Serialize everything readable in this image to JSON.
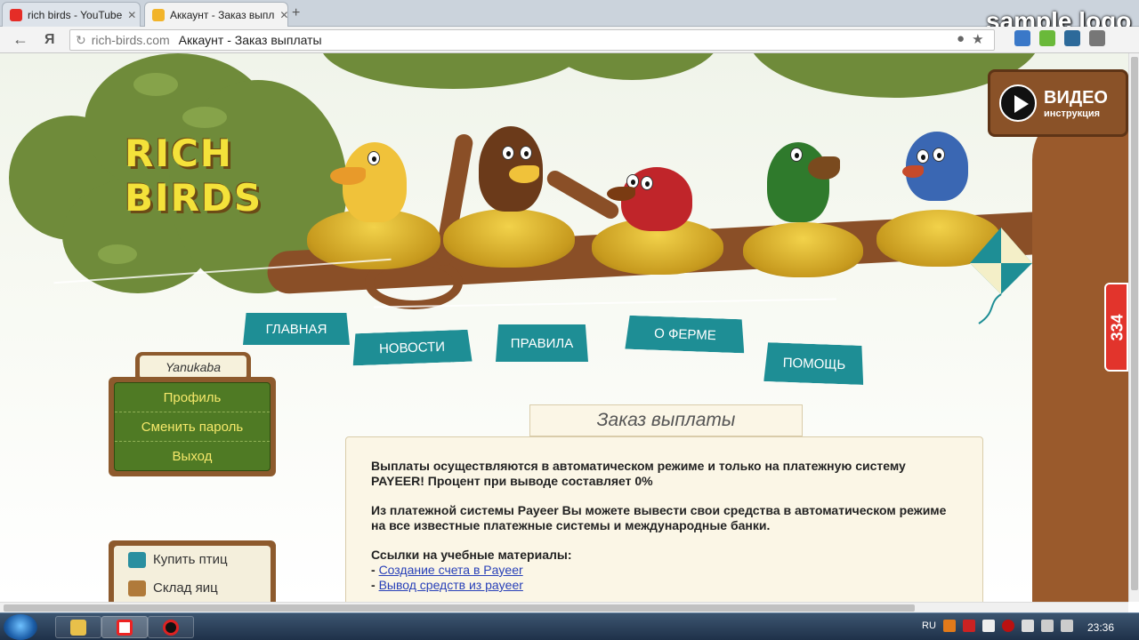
{
  "browser": {
    "tabs": [
      {
        "title": "rich birds - YouTube",
        "active": false
      },
      {
        "title": "Аккаунт - Заказ выпл",
        "active": true
      }
    ],
    "new_tab_symbol": "+",
    "watermark": "sample logo",
    "yandex_button": "Я",
    "address": {
      "domain": "rich-birds.com",
      "page_title": "Аккаунт - Заказ выплаты"
    }
  },
  "site": {
    "logo_line1": "RICH",
    "logo_line2": "BIRDS",
    "video": {
      "title": "ВИДЕО",
      "subtitle": "инструкция"
    },
    "counter": "334",
    "nav": [
      {
        "label": "ГЛАВНАЯ"
      },
      {
        "label": "НОВОСТИ"
      },
      {
        "label": "ПРАВИЛА"
      },
      {
        "label": "О ФЕРМЕ"
      },
      {
        "label": "ПОМОЩЬ"
      }
    ],
    "user": {
      "name": "Yanukaba",
      "menu": [
        "Профиль",
        "Сменить пароль",
        "Выход"
      ]
    },
    "shop_menu": [
      "Купить птиц",
      "Склад яиц"
    ],
    "content": {
      "title": "Заказ выплаты",
      "para1": "Выплаты осуществляются в автоматическом режиме и только на платежную систему PAYEER! Процент при выводе составляет 0%",
      "para2": "Из платежной системы Payeer Вы можете вывести свои средства в автоматическом режиме на все известные платежные системы и международные банки.",
      "links_heading": "Ссылки на учебные материалы:",
      "link1": "Создание счета в Payeer",
      "link2": "Вывод средств из payeer",
      "bullet": "- "
    }
  },
  "taskbar": {
    "lang": "RU",
    "time": "23:36"
  },
  "colors": {
    "sign_teal": "#1e8e95",
    "menu_green": "#4f7a24",
    "wood": "#8d5a2d",
    "counter_red": "#e2342c"
  }
}
